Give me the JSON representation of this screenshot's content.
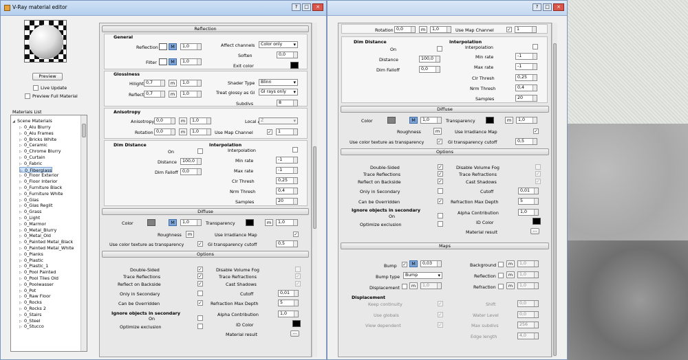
{
  "window_title": "V-Ray material editor",
  "window_buttons": [
    "?",
    "□",
    "×"
  ],
  "preview": {
    "button": "Preview",
    "live_update": "Live Update",
    "preview_full": "Preview Full Material"
  },
  "materials": {
    "title": "Materials List",
    "root": "Scene Materials",
    "selected": "0_Fiberglass",
    "items": [
      "0_Alu Blurry",
      "0_Alu Frames",
      "0_Bricks White",
      "0_Ceramic",
      "0_Chrome Blurry",
      "0_Curtain",
      "0_Fabric",
      "0_Fiberglass",
      "0_Floor Exterior",
      "0_Floor Interior",
      "0_Furniture Black",
      "0_Furniture White",
      "0_Glas",
      "0_Glas Reglit",
      "0_Grass",
      "0_Light",
      "0_Marmor",
      "0_Metal_Blurry",
      "0_Metal_Old",
      "0_Painted Metal_Black",
      "0_Painted Metal_White",
      "0_Planks",
      "0_Plastic",
      "0_Plastic_1",
      "0_Pool Painted",
      "0_Pool Tiles Old",
      "0_Poolwasser",
      "0_Pot",
      "0_Raw Floor",
      "0_Rocks",
      "0_Rocks 2",
      "0_Stairs",
      "0_Steel",
      "0_Stucco"
    ]
  },
  "reflection": {
    "header": "Reflection",
    "general": "General",
    "reflection_label": "Reflection",
    "reflection_val": "1,0",
    "filter_label": "Filter",
    "filter_val": "1,0",
    "affect_channels": "Affect channels",
    "affect_channels_val": "Color only",
    "soften": "Soften",
    "soften_val": "0,0",
    "exit_color": "Exit color",
    "glossiness": "Glossiness",
    "hilight": "Hilight",
    "hilight_val": "0,7",
    "hilight_mult": "1,0",
    "reflect": "Reflect",
    "reflect_val": "0,7",
    "reflect_mult": "1,0",
    "shader_type": "Shader Type",
    "shader_type_val": "Blinn",
    "treat_glossy": "Treat glossy as GI",
    "treat_glossy_val": "GI rays only",
    "subdivs": "Subdivs",
    "subdivs_val": "8",
    "anisotropy": "Anisotropy",
    "aniso_label": "Anisotropy",
    "aniso_val": "0,0",
    "aniso_mult": "1,0",
    "local_axis": "Local Axis",
    "local_axis_val": "Z",
    "rotation": "Rotation",
    "rotation_val": "0,0",
    "rotation_mult": "1,0",
    "use_map_channel": "Use Map Channel",
    "map_channel_val": "1",
    "dim_distance": "Dim Distance",
    "on": "On",
    "distance": "Distance",
    "distance_val": "100,0",
    "dim_falloff": "Dim Falloff",
    "dim_falloff_val": "0,0",
    "interpolation": "Interpolation",
    "interp_label": "Interpolation",
    "min_rate": "Min rate",
    "min_rate_val": "-1",
    "max_rate": "Max rate",
    "max_rate_val": "-1",
    "clr_thresh": "Clr Thresh",
    "clr_thresh_val": "0,25",
    "nrm_thresh": "Nrm Thresh",
    "nrm_thresh_val": "0,4",
    "samples": "Samples",
    "samples_val": "20",
    "m": "M",
    "m_small": "m"
  },
  "diffuse": {
    "header": "Diffuse",
    "color": "Color",
    "color_val": "1,0",
    "transparency": "Transparency",
    "transparency_val": "1,0",
    "roughness": "Roughness",
    "use_irradiance": "Use Irradiance Map",
    "use_color_tex": "Use color texture as transparency",
    "gi_cutoff": "GI transparency cutoff",
    "gi_cutoff_val": "0,5"
  },
  "options": {
    "header": "Options",
    "double_sided": "Double-Sided",
    "trace_reflections": "Trace Reflections",
    "reflect_backside": "Reflect on Backside",
    "only_secondary": "Only in Secondary",
    "can_be_overridden": "Can be Overridden",
    "ignore_secondary": "Ignore objects in secondary",
    "on": "On",
    "optimize_exclusion": "Optimize exclusion",
    "disable_volume_fog": "Disable Volume Fog",
    "trace_refractions": "Trace Refractions",
    "cast_shadows": "Cast Shadows",
    "cutoff": "Cutoff",
    "cutoff_val": "0,01",
    "refraction_max_depth": "Refraction Max Depth",
    "refraction_max_depth_val": "5",
    "alpha_contribution": "Alpha Contribution",
    "alpha_contribution_val": "1,0",
    "id_color": "ID Color",
    "material_result": "Material result",
    "ellipsis": "..."
  },
  "maps": {
    "header": "Maps",
    "bump": "Bump",
    "bump_val": "0,03",
    "bump_type": "Bump type",
    "bump_type_val": "Bump",
    "displacement": "Displacement",
    "displacement_val": "1,0",
    "background": "Background",
    "background_val": "1,0",
    "reflection": "Reflection",
    "reflection_val": "1,0",
    "refraction": "Refraction",
    "refraction_val": "1,0",
    "disp_group": "Displacement",
    "keep_continuity": "Keep continuity",
    "use_globals": "Use globals",
    "view_dependent": "View dependent",
    "shift": "Shift",
    "shift_val": "0,0",
    "water_level": "Water Level",
    "water_level_val": "0,0",
    "max_subdivs": "Max subdivs",
    "max_subdivs_val": "256",
    "edge_length": "Edge length",
    "edge_length_val": "4,0"
  },
  "colors": {
    "accent": "#7ea6d8",
    "titlebar": "#b5cfee",
    "close": "#d8564a"
  }
}
